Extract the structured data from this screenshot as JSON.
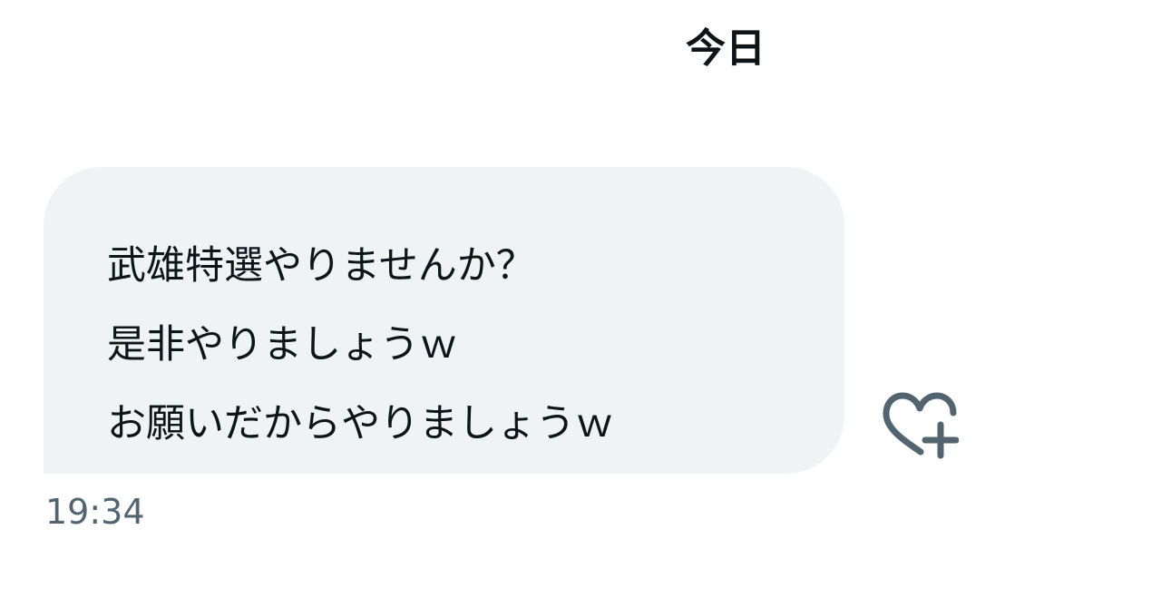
{
  "conversation": {
    "day_divider": "今日",
    "message": {
      "lines": [
        "武雄特選やりませんか？",
        "是非やりましょうｗ",
        "お願いだからやりましょうｗ"
      ],
      "timestamp": "19:34",
      "reaction_icon": "heart-plus-icon"
    }
  },
  "colors": {
    "bubble_background": "#eff3f4",
    "text": "#0f1419",
    "secondary_text": "#536471"
  }
}
